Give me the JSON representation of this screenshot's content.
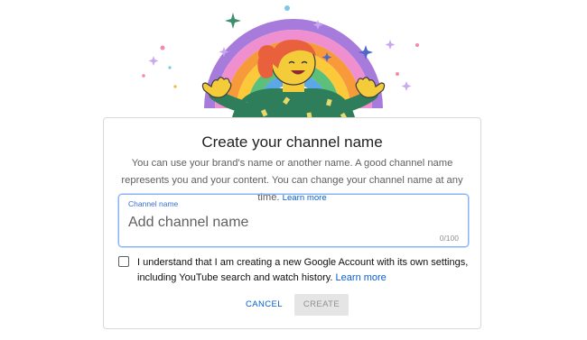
{
  "dialog": {
    "title": "Create your channel name",
    "description": "You can use your brand's name or another name. A good channel name represents you and your content. You can change your channel name at any time.",
    "learn_more": "Learn more",
    "field": {
      "label": "Channel name",
      "placeholder": "Add channel name",
      "value": "",
      "counter": "0/100"
    },
    "consent": {
      "checked": false,
      "text": "I understand that I am creating a new Google Account with its own settings, including YouTube search and watch history.",
      "learn_more": "Learn more"
    },
    "buttons": {
      "cancel": "CANCEL",
      "create": "CREATE"
    }
  },
  "colors": {
    "link": "#065fd4",
    "focus_border": "#8ab4f8",
    "disabled_bg": "#e5e5e5",
    "disabled_text": "#909090"
  },
  "illustration": {
    "icon": "rainbow-person-illustration"
  }
}
